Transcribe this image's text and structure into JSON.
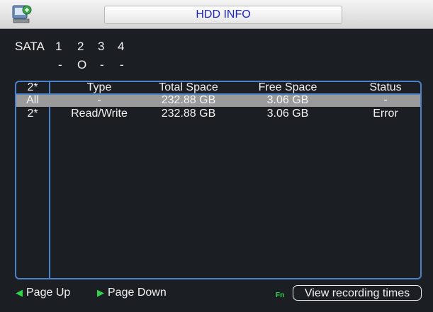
{
  "window": {
    "title": "HDD INFO",
    "icon": "hdd-info-icon"
  },
  "sata": {
    "label": "SATA",
    "ports": [
      "1",
      "2",
      "3",
      "4"
    ],
    "states": [
      "-",
      "O",
      "-",
      "-"
    ]
  },
  "table": {
    "columns": [
      "2*",
      "Type",
      "Total Space",
      "Free Space",
      "Status"
    ],
    "rows": [
      {
        "id": "All",
        "type": "-",
        "total": "232.88 GB",
        "free": "3.06 GB",
        "status": "-"
      },
      {
        "id": "2*",
        "type": "Read/Write",
        "total": "232.88 GB",
        "free": "3.06 GB",
        "status": "Error"
      }
    ]
  },
  "footer": {
    "page_up_label": "Page Up",
    "page_down_label": "Page Down",
    "fn_label": "Fn",
    "view_recording_label": "View recording times"
  },
  "colors": {
    "accent_blue": "#4c82c9",
    "title_text": "#1d24c8",
    "nav_green": "#2fd44a",
    "selected_row": "#9a9a9a"
  }
}
